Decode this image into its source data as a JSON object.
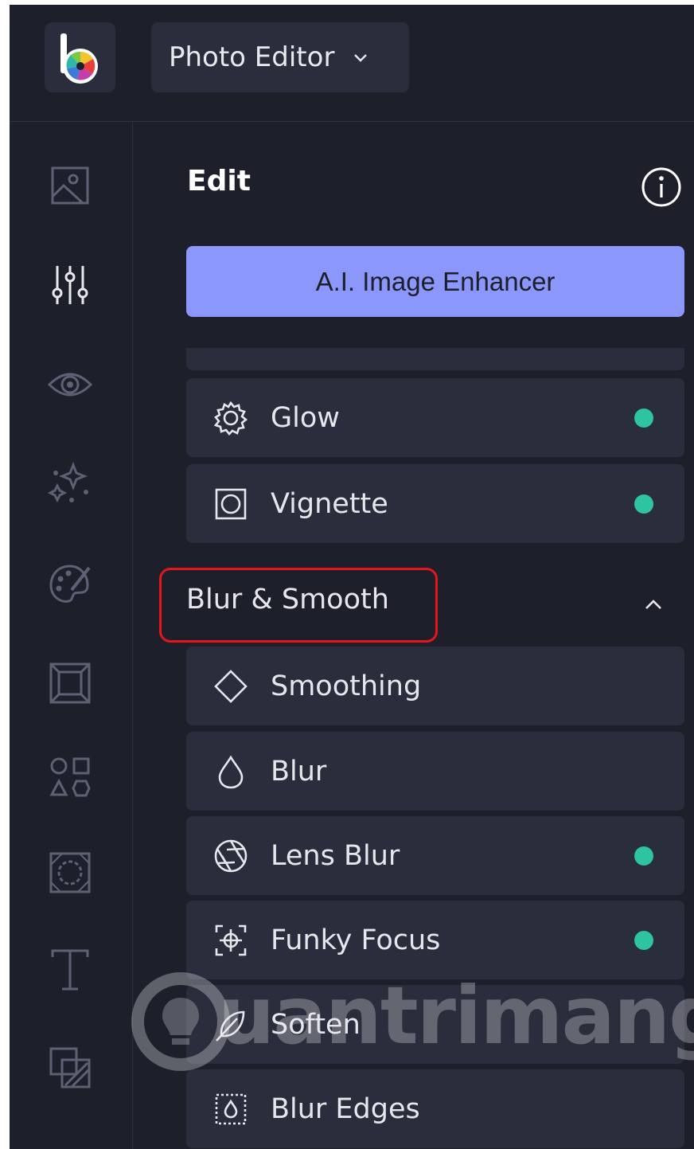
{
  "header": {
    "app_menu_label": "Photo Editor"
  },
  "sidebar": {
    "items": [
      {
        "name": "image-icon",
        "active": false
      },
      {
        "name": "sliders-icon",
        "active": true
      },
      {
        "name": "eye-icon",
        "active": false
      },
      {
        "name": "sparkles-icon",
        "active": false
      },
      {
        "name": "palette-icon",
        "active": false
      },
      {
        "name": "frame-icon",
        "active": false
      },
      {
        "name": "shapes-icon",
        "active": false
      },
      {
        "name": "texture-icon",
        "active": false
      },
      {
        "name": "text-icon",
        "active": false
      },
      {
        "name": "layers-icon",
        "active": false
      }
    ]
  },
  "panel": {
    "title": "Edit",
    "ai_button_label": "A.I. Image Enhancer",
    "tools_top": [
      {
        "label": "Glow",
        "icon": "gear-icon",
        "premium": true
      },
      {
        "label": "Vignette",
        "icon": "vignette-icon",
        "premium": true
      }
    ],
    "section_title": "Blur & Smooth",
    "section_tools": [
      {
        "label": "Smoothing",
        "icon": "diamond-icon",
        "premium": false
      },
      {
        "label": "Blur",
        "icon": "drop-icon",
        "premium": false
      },
      {
        "label": "Lens Blur",
        "icon": "aperture-icon",
        "premium": true
      },
      {
        "label": "Funky Focus",
        "icon": "focus-icon",
        "premium": true
      },
      {
        "label": "Soften",
        "icon": "feather-icon",
        "premium": false
      },
      {
        "label": "Blur Edges",
        "icon": "blur-edges-icon",
        "premium": false
      }
    ]
  },
  "watermark": {
    "text": "uantrimang"
  },
  "colors": {
    "background": "#1d1f2b",
    "panel": "#2a2d3b",
    "accent": "#8b97fb",
    "premium_dot": "#2ec4a0",
    "highlight": "#e3161c",
    "icon": "#5d6173"
  }
}
